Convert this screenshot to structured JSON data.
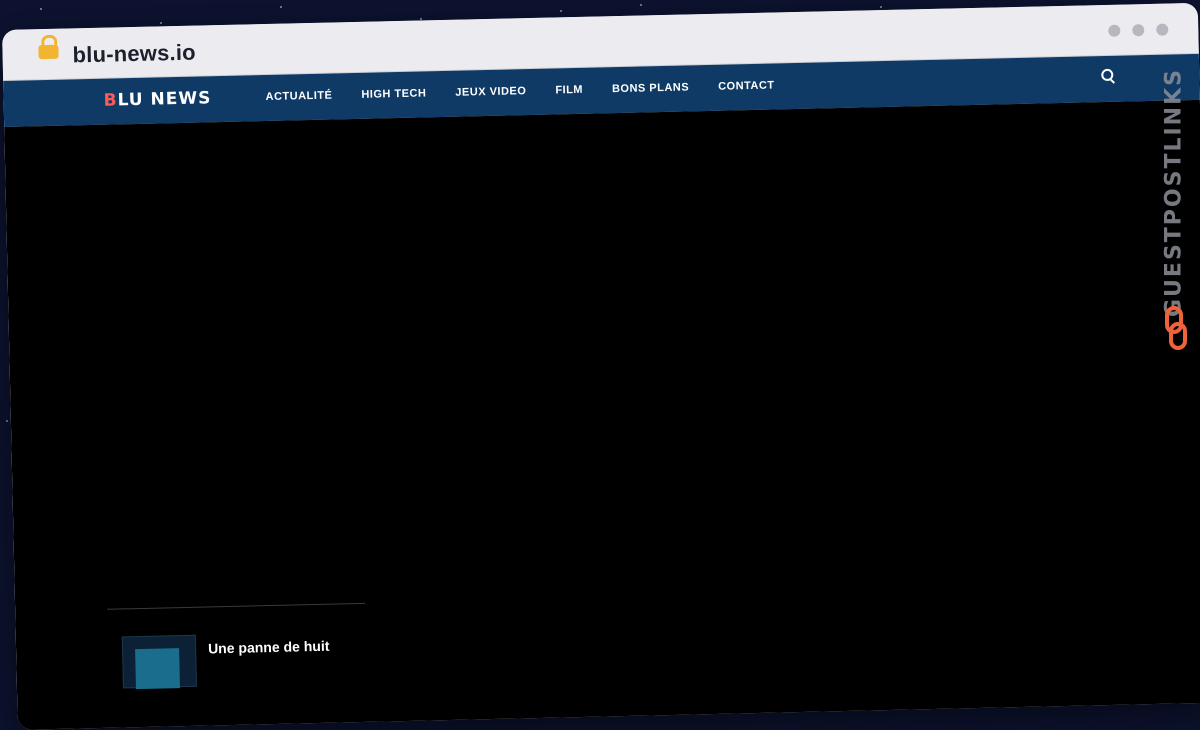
{
  "browser": {
    "url": "blu-news.io"
  },
  "site": {
    "logo_first_letter": "B",
    "logo_rest": "LU NEWS",
    "nav_items": [
      "ACTUALITÉ",
      "HIGH TECH",
      "JEUX VIDEO",
      "FILM",
      "BONS PLANS",
      "CONTACT"
    ]
  },
  "main": {
    "article_title": "Une panne de huit"
  },
  "watermark": {
    "text": "GUESTPOSTLINKS"
  },
  "colors": {
    "nav_bg": "#0f3a66",
    "logo_accent": "#ff5a5a",
    "lock": "#f3b431",
    "watermark_icon": "#f0633a"
  },
  "icons": {
    "lock": "lock-icon",
    "search": "search-icon",
    "watermark": "link-chain-icon"
  }
}
